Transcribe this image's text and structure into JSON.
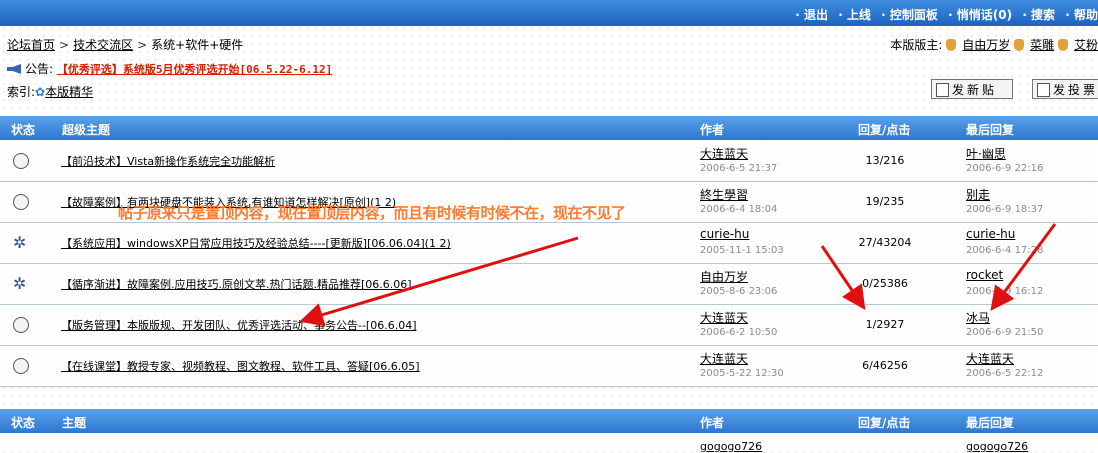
{
  "topbar": {
    "links": [
      "· 退出",
      "· 上线",
      "· 控制面板",
      "· 悄悄话(0)",
      "· 搜索",
      "· 帮助"
    ]
  },
  "breadcrumb": {
    "home": "论坛首页",
    "section": "技术交流区",
    "current": "系统+软件+硬件"
  },
  "moderators": {
    "label": "本版版主:",
    "names": [
      "自由万岁",
      "菜雕",
      "艾粉"
    ]
  },
  "notice": {
    "label": "公告:",
    "text": "【优秀评选】系统版5月优秀评选开始[06.5.22-6.12]"
  },
  "index": {
    "label": "索引:",
    "link": "本版精华"
  },
  "buttons": {
    "new_post": "发新贴",
    "new_poll": "发投票"
  },
  "table1": {
    "headers": {
      "status": "状态",
      "topic": "超级主题",
      "author": "作者",
      "replies": "回复/点击",
      "last": "最后回复"
    },
    "rows": [
      {
        "status_icon": "topic-icon",
        "title": "【前沿技术】Vista新操作系统完全功能解析",
        "author": "大连蓝天",
        "author_date": "2006-6-5 21:37",
        "counts": "13/216",
        "last_user": "叶·幽思",
        "last_date": "2006-6-9 22:16"
      },
      {
        "status_icon": "topic-icon",
        "title": "【故障案例】有两块硬盘不能装入系统,有谁知道怎样解决[原创](1 2)",
        "author": "終生學習",
        "author_date": "2006-6-4 18:04",
        "counts": "19/235",
        "last_user": "别走",
        "last_date": "2006-6-9 18:37"
      },
      {
        "status_icon": "hot-topic-icon",
        "title": "【系统应用】windowsXP日常应用技巧及经验总结----[更新版][06.06.04](1 2)",
        "author": "curie-hu",
        "author_date": "2005-11-1 15:03",
        "counts": "27/43204",
        "last_user": "curie-hu",
        "last_date": "2006-6-4 17:28"
      },
      {
        "status_icon": "hot-topic-icon",
        "title": "【循序渐进】故障案例.应用技巧.原创文萃.热门话题.精品推荐[06.6.06]",
        "author": "自由万岁",
        "author_date": "2005-8-6 23:06",
        "counts": "0/25386",
        "last_user": "rocket",
        "last_date": "2006-6-9 16:12"
      },
      {
        "status_icon": "topic-icon",
        "title": "【版务管理】本版版规、开发团队、优秀评选活动、事务公告--[06.6.04]",
        "author": "大连蓝天",
        "author_date": "2006-6-2 10:50",
        "counts": "1/2927",
        "last_user": "冰马",
        "last_date": "2006-6-9 21:50"
      },
      {
        "status_icon": "topic-icon",
        "title": "【在线课堂】教授专家、视频教程、图文教程、软件工具、答疑[06.6.05]",
        "author": "大连蓝天",
        "author_date": "2005-5-22 12:30",
        "counts": "6/46256",
        "last_user": "大连蓝天",
        "last_date": "2006-6-5 22:12"
      }
    ]
  },
  "table2": {
    "headers": {
      "status": "状态",
      "topic": "主题",
      "author": "作者",
      "replies": "回复/点击",
      "last": "最后回复"
    },
    "first_author": "gogogo726",
    "first_last": "gogogo726"
  },
  "annotation": "帖子原来只是置顶内容，现在置顶层内容，而且有时候有时候不在，现在不见了",
  "colors": {
    "header_blue": "#2c77cf",
    "annotation": "#ff7a30",
    "arrow": "#e01010",
    "notice_red": "#d61e00"
  }
}
